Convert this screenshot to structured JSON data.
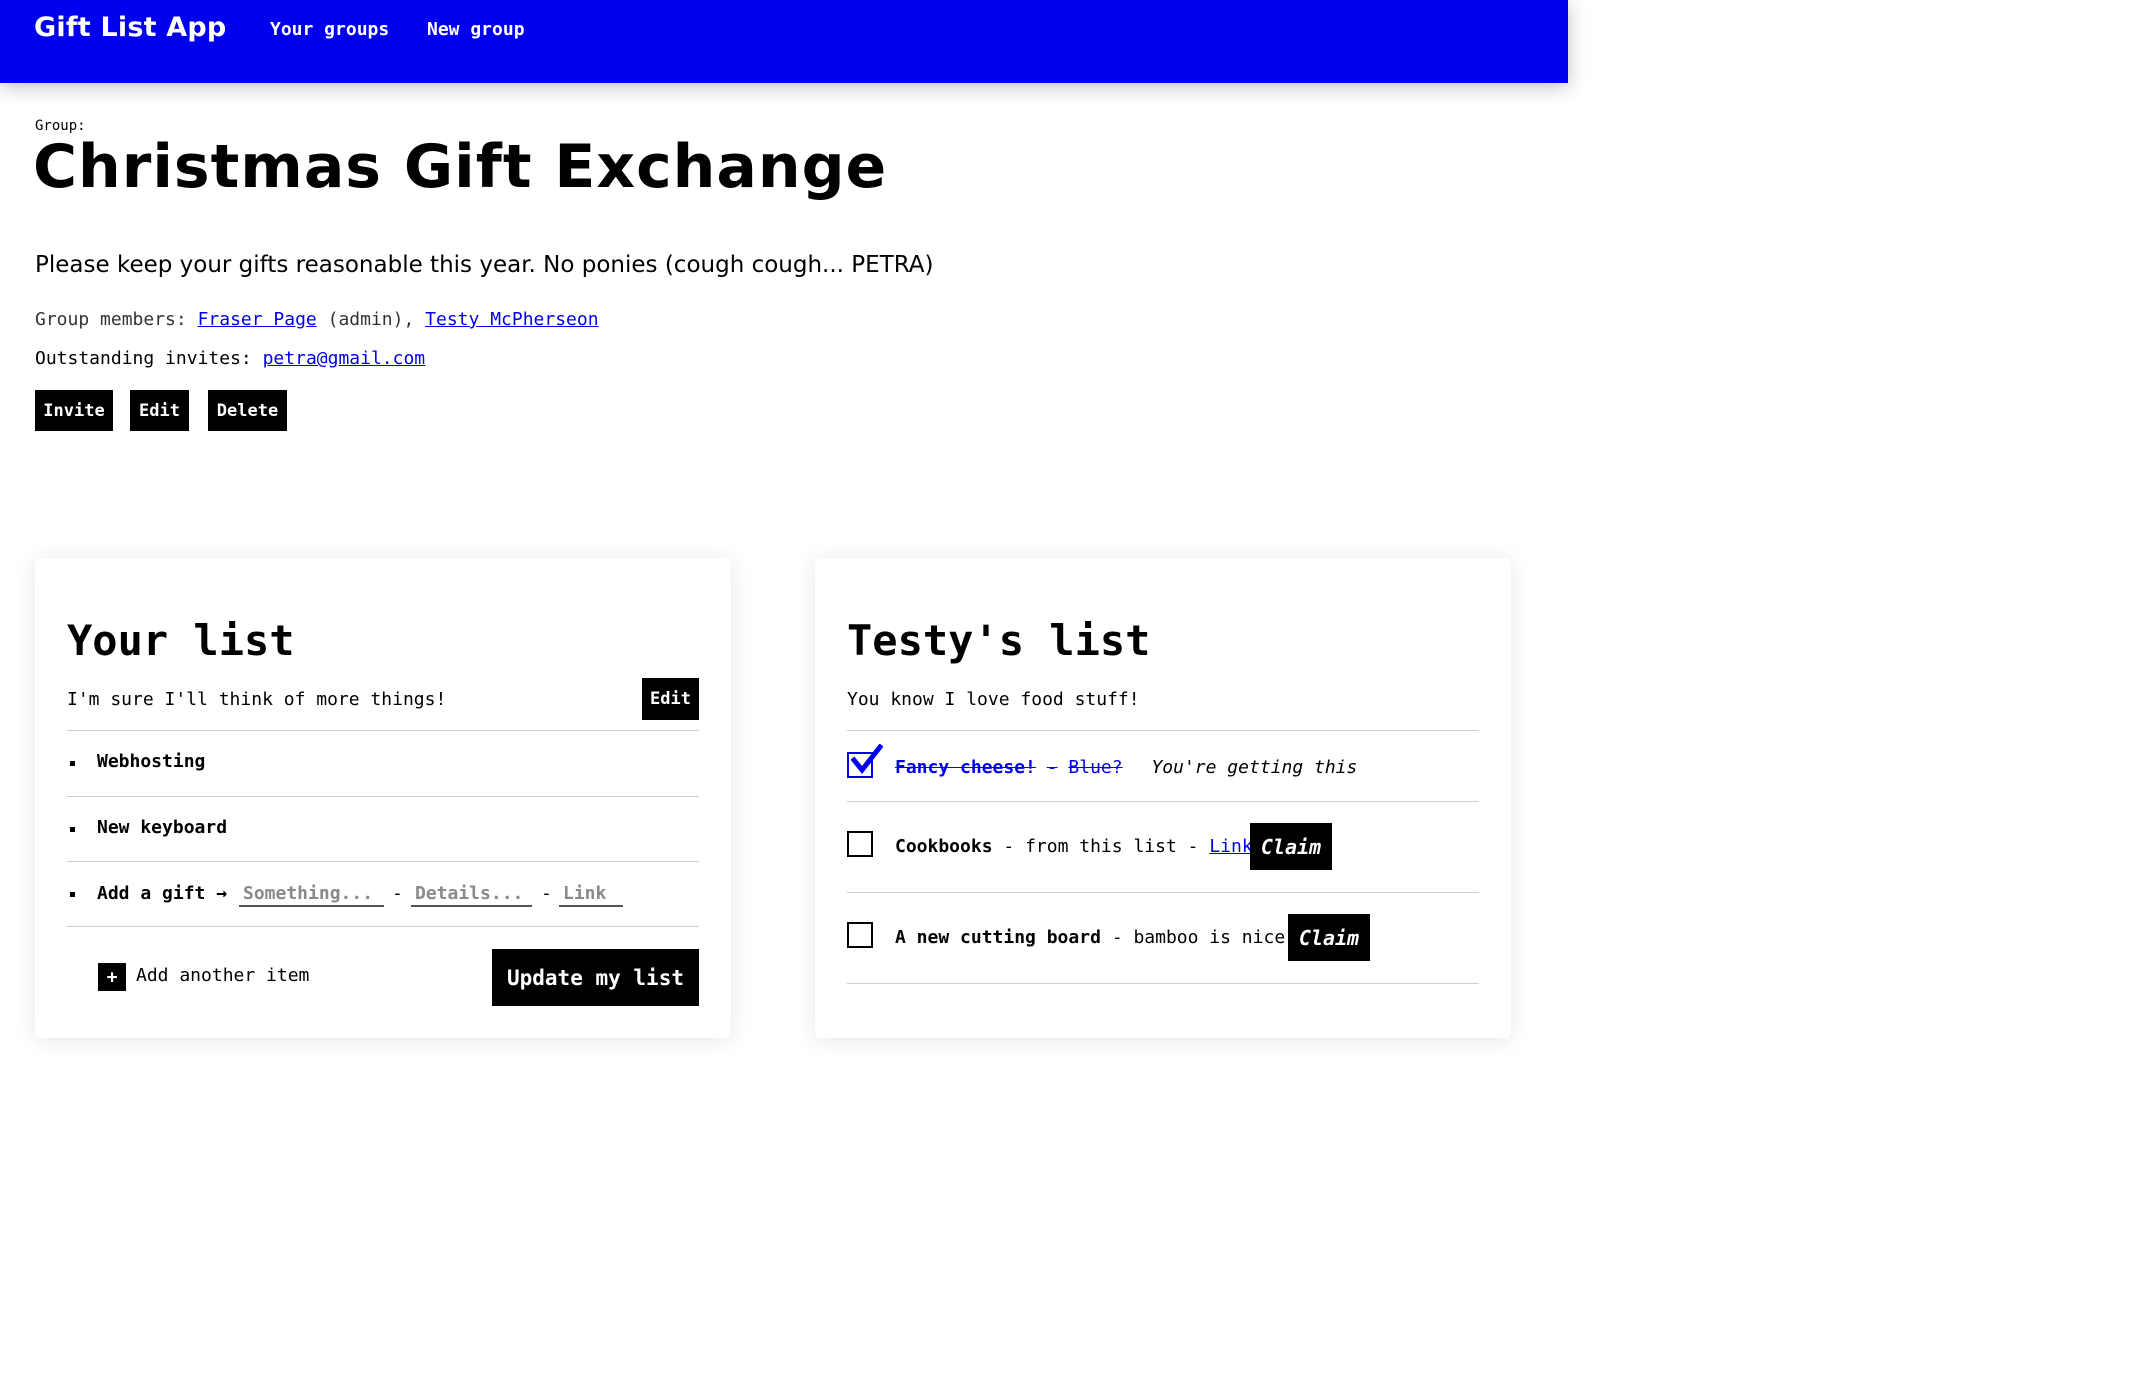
{
  "nav": {
    "brand": "Gift List App",
    "links": [
      "Your groups",
      "New group"
    ]
  },
  "group": {
    "label": "Group:",
    "title": "Christmas Gift Exchange",
    "description": "Please keep your gifts reasonable this year. No ponies (cough cough... PETRA)",
    "members_label": "Group members:",
    "members": [
      {
        "name": "Fraser Page",
        "suffix": "(admin)"
      },
      {
        "name": "Testy McPherseon"
      }
    ],
    "invites_label": "Outstanding invites:",
    "invites": [
      "petra@gmail.com"
    ],
    "actions": [
      "Invite",
      "Edit",
      "Delete"
    ]
  },
  "your_list": {
    "title": "Your list",
    "description": "I'm sure I'll think of more things!",
    "edit_label": "Edit",
    "items": [
      "Webhosting",
      "New keyboard"
    ],
    "add_gift_label": "Add a gift →",
    "placeholders": {
      "name": "Something...",
      "details": "Details...",
      "link": "Link"
    },
    "separator": "-",
    "add_another_icon": "+",
    "add_another_label": "Add another item",
    "update_label": "Update my list"
  },
  "other_list": {
    "title": "Testy's list",
    "description": "You know I love food stuff!",
    "gifts": [
      {
        "name": "Fancy cheese!",
        "details": "Blue?",
        "claimed": true,
        "status": "You're getting this"
      },
      {
        "name": "Cookbooks",
        "details": "from this list",
        "link_label": "Link",
        "claimed": false,
        "claim_label": "Claim"
      },
      {
        "name": "A new cutting board",
        "details": "bamboo is nice",
        "claimed": false,
        "claim_label": "Claim"
      }
    ]
  },
  "colors": {
    "nav_bg": "#0000ee",
    "link": "#0000ee",
    "button_bg": "#000000",
    "button_text": "#ffffff"
  }
}
